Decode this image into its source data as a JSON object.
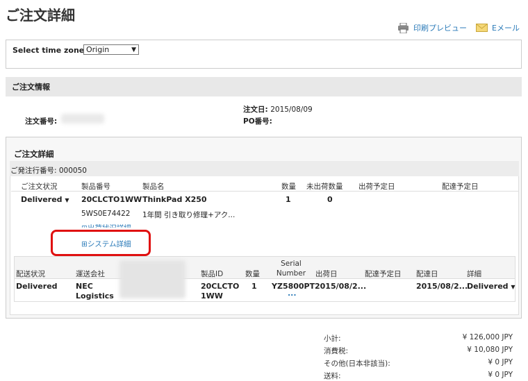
{
  "page": {
    "title": "ご注文詳細"
  },
  "toolbar": {
    "print_label": "印刷プレビュー",
    "email_label": "Eメール"
  },
  "timezone": {
    "label": "Select time zone:",
    "selected": "Origin"
  },
  "order_info": {
    "section_title": "ご注文情報",
    "order_number_label": "注文番号:",
    "order_date_label": "注文日:",
    "order_date": "2015/08/09",
    "po_label": "PO番号:"
  },
  "order_detail": {
    "section_title": "ご注文詳細",
    "po_issue": "ご発注行番号: 000050",
    "columns": [
      "ご注文状況",
      "製品番号",
      "製品名",
      "数量",
      "未出荷数量",
      "出荷予定日",
      "配達予定日"
    ],
    "row": {
      "status": "Delivered",
      "product_number": "20CLCTO1WW",
      "product_name": "ThinkPad X250",
      "quantity": "1",
      "unshipped": "0",
      "sub_product_number": "5WS0E74422",
      "sub_product_name": "1年間 引き取り修理+アク...",
      "partial_link": "出荷状況詳細",
      "system_link": "システム詳細"
    }
  },
  "shipment": {
    "columns": [
      "配送状況",
      "運送会社",
      "製品ID",
      "数量",
      "Serial Number",
      "出荷日",
      "配達予定日",
      "配達日",
      "詳細"
    ],
    "row": {
      "status": "Delivered",
      "carrier_line1": "NEC",
      "carrier_line2": "Logistics",
      "product_id_line1": "20CLCTO",
      "product_id_line2": "1WW",
      "quantity": "1",
      "serial": "YZ5800PT",
      "serial_more": "...",
      "ship_date": "2015/08/2...",
      "delivery_date": "2015/08/2...",
      "detail": "Delivered"
    }
  },
  "totals": {
    "subtotal_label": "小計:",
    "subtotal": "¥ 126,000 JPY",
    "tax_label": "消費税:",
    "tax": "¥ 10,080 JPY",
    "other_label": "その他(日本非該当):",
    "other": "¥ 0 JPY",
    "shipping_label": "送料:",
    "shipping": "¥ 0 JPY"
  }
}
